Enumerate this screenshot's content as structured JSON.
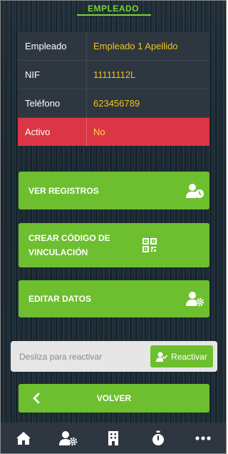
{
  "header": {
    "title": "EMPLEADO"
  },
  "info": [
    {
      "label": "Empleado",
      "value": "Empleado 1 Apellido"
    },
    {
      "label": "NIF",
      "value": "11111112L"
    },
    {
      "label": "Teléfono",
      "value": "623456789"
    },
    {
      "label": "Activo",
      "value": "No"
    }
  ],
  "actions": {
    "ver_registros": "VER REGISTROS",
    "crear_codigo": "CREAR CÓDIGO DE VINCULACIÓN",
    "editar_datos": "EDITAR DATOS"
  },
  "slider": {
    "placeholder": "Desliza para reactivar",
    "button": "Reactivar"
  },
  "back": {
    "label": "VOLVER"
  },
  "nav": [
    {
      "icon": "home-icon"
    },
    {
      "icon": "user-settings-icon"
    },
    {
      "icon": "building-icon"
    },
    {
      "icon": "stopwatch-icon"
    },
    {
      "icon": "more-icon"
    }
  ],
  "colors": {
    "accent": "#6dbf2f",
    "title": "#7ad13a",
    "value": "#f2c21b",
    "inactive": "#dc3545",
    "panel": "#2e3740"
  }
}
